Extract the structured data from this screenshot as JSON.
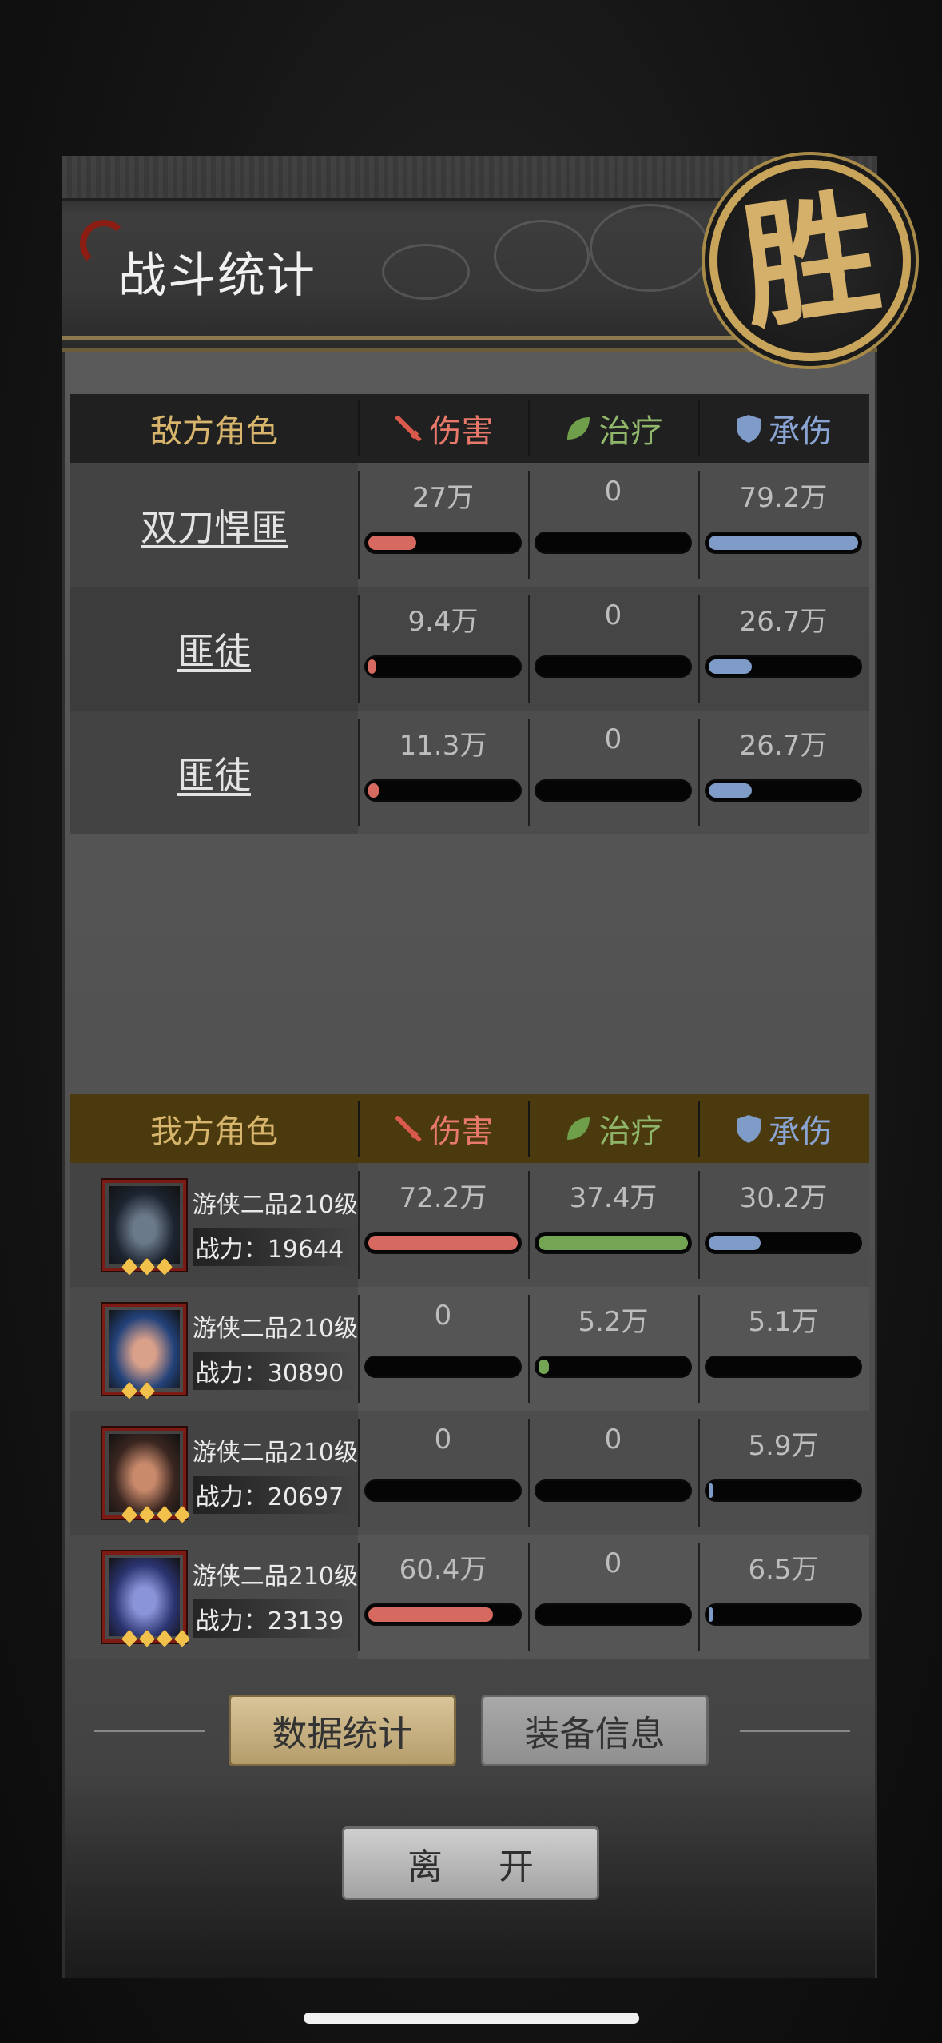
{
  "header": {
    "title": "战斗统计",
    "result_seal": "胜"
  },
  "columns": {
    "damage": "伤害",
    "heal": "治疗",
    "tank": "承伤",
    "damage_icon": "sword-icon",
    "heal_icon": "leaf-icon",
    "tank_icon": "shield-icon"
  },
  "colors": {
    "damage": "#d66a60",
    "heal": "#74a554",
    "tank": "#7f9bc8",
    "enemy_header": "#d8b56c"
  },
  "enemy": {
    "header": "敌方角色",
    "rows": [
      {
        "name": "双刀悍匪",
        "damage": "27万",
        "damage_pct": 0.34,
        "heal": "0",
        "heal_pct": 0,
        "tank": "79.2万",
        "tank_pct": 1.0
      },
      {
        "name": "匪徒",
        "damage": "9.4万",
        "damage_pct": 0.08,
        "heal": "0",
        "heal_pct": 0,
        "tank": "26.7万",
        "tank_pct": 0.31
      },
      {
        "name": "匪徒",
        "damage": "11.3万",
        "damage_pct": 0.1,
        "heal": "0",
        "heal_pct": 0,
        "tank": "26.7万",
        "tank_pct": 0.31
      }
    ]
  },
  "ally": {
    "header": "我方角色",
    "rows": [
      {
        "title": "游侠二品210级",
        "power": "战力：19644",
        "damage": "72.2万",
        "damage_pct": 1.0,
        "heal": "37.4万",
        "heal_pct": 1.0,
        "tank": "30.2万",
        "tank_pct": 0.37,
        "stars": 3
      },
      {
        "title": "游侠二品210级",
        "power": "战力：30890",
        "damage": "0",
        "damage_pct": 0,
        "heal": "5.2万",
        "heal_pct": 0.1,
        "tank": "5.1万",
        "tank_pct": 0,
        "stars": 2
      },
      {
        "title": "游侠二品210级",
        "power": "战力：20697",
        "damage": "0",
        "damage_pct": 0,
        "heal": "0",
        "heal_pct": 0,
        "tank": "5.9万",
        "tank_pct": 0.02,
        "stars": 4
      },
      {
        "title": "游侠二品210级",
        "power": "战力：23139",
        "damage": "60.4万",
        "damage_pct": 0.84,
        "heal": "0",
        "heal_pct": 0,
        "tank": "6.5万",
        "tank_pct": 0.02,
        "stars": 4
      }
    ]
  },
  "tabs": {
    "stats": "数据统计",
    "equipment": "装备信息"
  },
  "leave": {
    "char1": "离",
    "char2": "开"
  }
}
